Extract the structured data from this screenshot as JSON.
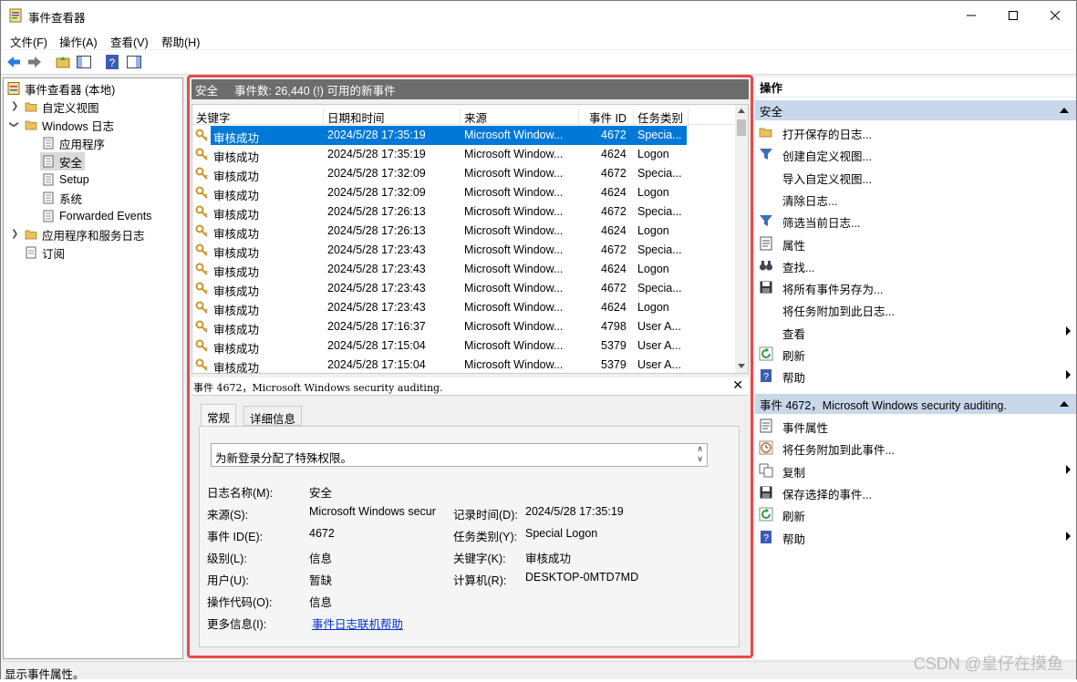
{
  "window": {
    "title": "事件查看器"
  },
  "menu": [
    "文件(F)",
    "操作(A)",
    "查看(V)",
    "帮助(H)"
  ],
  "tree": {
    "root": "事件查看器 (本地)",
    "custom_views": "自定义视图",
    "windows_logs": "Windows 日志",
    "logs": [
      "应用程序",
      "安全",
      "Setup",
      "系统",
      "Forwarded Events"
    ],
    "app_service_logs": "应用程序和服务日志",
    "subscriptions": "订阅"
  },
  "center": {
    "log_name": "安全",
    "event_count": "事件数: 26,440 (!) 可用的新事件",
    "columns": [
      "关键字",
      "日期和时间",
      "来源",
      "事件 ID",
      "任务类别"
    ],
    "rows": [
      [
        "审核成功",
        "2024/5/28 17:35:19",
        "Microsoft Window...",
        "4672",
        "Specia..."
      ],
      [
        "审核成功",
        "2024/5/28 17:35:19",
        "Microsoft Window...",
        "4624",
        "Logon"
      ],
      [
        "审核成功",
        "2024/5/28 17:32:09",
        "Microsoft Window...",
        "4672",
        "Specia..."
      ],
      [
        "审核成功",
        "2024/5/28 17:32:09",
        "Microsoft Window...",
        "4624",
        "Logon"
      ],
      [
        "审核成功",
        "2024/5/28 17:26:13",
        "Microsoft Window...",
        "4672",
        "Specia..."
      ],
      [
        "审核成功",
        "2024/5/28 17:26:13",
        "Microsoft Window...",
        "4624",
        "Logon"
      ],
      [
        "审核成功",
        "2024/5/28 17:23:43",
        "Microsoft Window...",
        "4672",
        "Specia..."
      ],
      [
        "审核成功",
        "2024/5/28 17:23:43",
        "Microsoft Window...",
        "4624",
        "Logon"
      ],
      [
        "审核成功",
        "2024/5/28 17:23:43",
        "Microsoft Window...",
        "4672",
        "Specia..."
      ],
      [
        "审核成功",
        "2024/5/28 17:23:43",
        "Microsoft Window...",
        "4624",
        "Logon"
      ],
      [
        "审核成功",
        "2024/5/28 17:16:37",
        "Microsoft Window...",
        "4798",
        "User A..."
      ],
      [
        "审核成功",
        "2024/5/28 17:15:04",
        "Microsoft Window...",
        "5379",
        "User A..."
      ],
      [
        "审核成功",
        "2024/5/28 17:15:04",
        "Microsoft Window...",
        "5379",
        "User A..."
      ]
    ],
    "detail_title": "事件 4672，Microsoft Windows security auditing.",
    "tabs": [
      "常规",
      "详细信息"
    ],
    "description": "为新登录分配了特殊权限。",
    "fields": {
      "log_name_label": "日志名称(M):",
      "log_name_value": "安全",
      "source_label": "来源(S):",
      "source_value": "Microsoft Windows secur",
      "logged_label": "记录时间(D):",
      "logged_value": "2024/5/28 17:35:19",
      "event_id_label": "事件 ID(E):",
      "event_id_value": "4672",
      "task_label": "任务类别(Y):",
      "task_value": "Special Logon",
      "level_label": "级别(L):",
      "level_value": "信息",
      "keywords_label": "关键字(K):",
      "keywords_value": "审核成功",
      "user_label": "用户(U):",
      "user_value": "暂缺",
      "computer_label": "计算机(R):",
      "computer_value": "DESKTOP-0MTD7MD",
      "opcode_label": "操作代码(O):",
      "opcode_value": "信息",
      "more_label": "更多信息(I):",
      "more_link": "事件日志联机帮助"
    }
  },
  "actions": {
    "header": "操作",
    "section1": "安全",
    "items1": [
      {
        "label": "打开保存的日志...",
        "icon": "folder-open-icon"
      },
      {
        "label": "创建自定义视图...",
        "icon": "filter-icon"
      },
      {
        "label": "导入自定义视图...",
        "icon": ""
      },
      {
        "label": "清除日志...",
        "icon": ""
      },
      {
        "label": "筛选当前日志...",
        "icon": "filter-icon"
      },
      {
        "label": "属性",
        "icon": "properties-icon"
      },
      {
        "label": "查找...",
        "icon": "binoculars-icon"
      },
      {
        "label": "将所有事件另存为...",
        "icon": "save-icon"
      },
      {
        "label": "将任务附加到此日志...",
        "icon": ""
      },
      {
        "label": "查看",
        "icon": ""
      },
      {
        "label": "刷新",
        "icon": "refresh-icon"
      },
      {
        "label": "帮助",
        "icon": "help-icon"
      }
    ],
    "section2": "事件 4672，Microsoft Windows security auditing.",
    "items2": [
      {
        "label": "事件属性",
        "icon": "properties-icon"
      },
      {
        "label": "将任务附加到此事件...",
        "icon": "clock-icon"
      },
      {
        "label": "复制",
        "icon": "copy-icon"
      },
      {
        "label": "保存选择的事件...",
        "icon": "save-icon"
      },
      {
        "label": "刷新",
        "icon": "refresh-icon"
      },
      {
        "label": "帮助",
        "icon": "help-icon"
      }
    ]
  },
  "status": "显示事件属性。",
  "watermark": "CSDN @皇仔在摸鱼",
  "colors": {
    "selection": "#0078d7",
    "highlight_border": "#e84a4a",
    "section_bg": "#c8d8ea"
  }
}
